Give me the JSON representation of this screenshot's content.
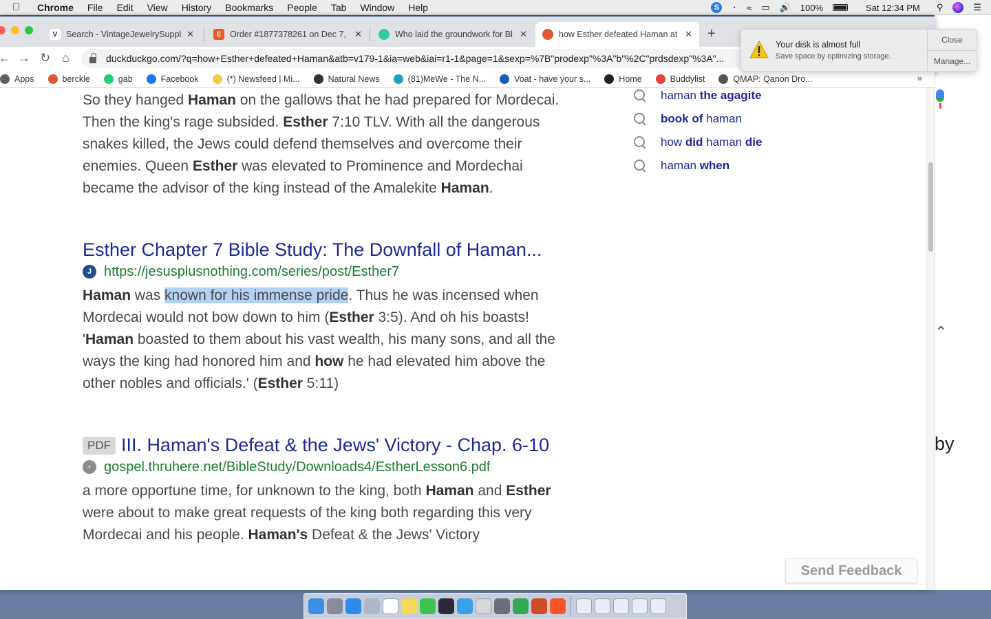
{
  "menubar": {
    "app": "Chrome",
    "items": [
      "File",
      "Edit",
      "View",
      "History",
      "Bookmarks",
      "People",
      "Tab",
      "Window",
      "Help"
    ],
    "battery": "100%",
    "clock": "Sat 12:34 PM",
    "skype_badge": "S"
  },
  "tabs": [
    {
      "title": "Search - VintageJewelrySuppl",
      "favicon": "V",
      "color": "#444444"
    },
    {
      "title": "Order #1877378261 on Dec 7,",
      "favicon": "E",
      "color": "#f05a1a"
    },
    {
      "title": "Who laid the groundwork for Bl",
      "favicon": "",
      "color": "#32c8a8"
    },
    {
      "title": "how Esther defeated Haman at",
      "favicon": "",
      "color": "#de5833"
    }
  ],
  "toolbar": {
    "url": "duckduckgo.com/?q=how+Esther+defeated+Haman&atb=v179-1&ia=web&iai=r1-1&page=1&sexp=%7B\"prodexp\"%3A\"b\"%2C\"prdsdexp\"%3A\"..."
  },
  "bookmarks": [
    {
      "label": "Apps",
      "icon": "apps-grid-icon",
      "color": "#5f6368"
    },
    {
      "label": "berckle",
      "icon": "duckduckgo-icon",
      "color": "#de5833"
    },
    {
      "label": "gab",
      "icon": "gab-icon",
      "color": "#21cf7a"
    },
    {
      "label": "Facebook",
      "icon": "facebook-icon",
      "color": "#1877f2"
    },
    {
      "label": "(*) Newsfeed | Mi...",
      "icon": "lightbulb-icon",
      "color": "#f2c94c"
    },
    {
      "label": "Natural News",
      "icon": "natural-news-icon",
      "color": "#333333"
    },
    {
      "label": "(81)MeWe - The N...",
      "icon": "mewe-icon",
      "color": "#1aa3b8"
    },
    {
      "label": "Voat - have your s...",
      "icon": "voat-icon",
      "color": "#1a5db8"
    },
    {
      "label": "Home",
      "icon": "home-glyph-icon",
      "color": "#222222"
    },
    {
      "label": "Buddylist",
      "icon": "buddylist-icon",
      "color": "#e0443e"
    },
    {
      "label": "QMAP: Qanon Dro...",
      "icon": "qmap-icon",
      "color": "#555555"
    }
  ],
  "results": {
    "first_snippet_html": "So they hanged <b>Haman</b> on the gallows that he had prepared for Mordecai. Then the king's rage subsided. <b>Esther</b> 7:10 TLV. With all the dangerous snakes killed, the Jews could defend themselves and overcome their enemies. Queen <b>Esther</b> was elevated to Prominence and Mordechai became the advisor of the king instead of the Amalekite <b>Haman</b>.",
    "r2_title": "Esther Chapter 7 Bible Study: The Downfall of Haman...",
    "r2_url": "https://jesusplusnothing.com/series/post/Esther7",
    "r2_snippet_html": "<b>Haman</b> was <span class=\"hl\">known for his immense pride</span>. Thus he was incensed when Mordecai would not bow down to him (<b>Esther</b> 3:5). And oh his boasts! '<b>Haman</b> boasted to them about his vast wealth, his many sons, and all the ways the king had honored him and <b>how</b> he had elevated him above the other nobles and officials.' (<b>Esther</b> 5:11)",
    "r3_tag": "PDF",
    "r3_title": "III. Haman's Defeat & the Jews' Victory - Chap. 6-10",
    "r3_url": "gospel.thruhere.net/BibleStudy/Downloads4/EstherLesson6.pdf",
    "r3_snippet_html": "a more opportune time, for unknown to the king, both <b>Haman</b> and <b>Esther</b> were about to make great requests of the king both regarding this very Mordecai and his people. <b>Haman's</b> Defeat &amp; the Jews' Victory"
  },
  "related": [
    {
      "html": "haman <b>the agagite</b>"
    },
    {
      "html": "<b>book of</b> haman"
    },
    {
      "html": "how <b>did</b> haman <b>die</b>"
    },
    {
      "html": "haman <b>when</b>"
    }
  ],
  "feedback_label": "Send Feedback",
  "side_peek_text": "by",
  "notification": {
    "title": "Your disk is almost full",
    "body": "Save space by optimizing storage.",
    "close": "Close",
    "manage": "Manage..."
  },
  "dock": [
    {
      "name": "finder-icon",
      "color": "#3a8ee6"
    },
    {
      "name": "launchpad-icon",
      "color": "#8a8a9a"
    },
    {
      "name": "safari-icon",
      "color": "#2d8ceb"
    },
    {
      "name": "help-icon",
      "color": "#b0b8c8"
    },
    {
      "name": "calendar-icon",
      "color": "#ffffff"
    },
    {
      "name": "notes-icon",
      "color": "#f7d85a"
    },
    {
      "name": "messages-icon",
      "color": "#3ec24f"
    },
    {
      "name": "quicktime-icon",
      "color": "#2a2a3a"
    },
    {
      "name": "chat-icon",
      "color": "#3aa0e8"
    },
    {
      "name": "script-editor-icon",
      "color": "#d7d7d7"
    },
    {
      "name": "system-preferences-icon",
      "color": "#6e6e78"
    },
    {
      "name": "chrome-icon",
      "color": "#34a853"
    },
    {
      "name": "powerpoint-icon",
      "color": "#d04a25"
    },
    {
      "name": "brave-icon",
      "color": "#fb542b"
    },
    {
      "name": "document-thumb-icon",
      "color": "#e9eef6"
    },
    {
      "name": "document-thumb-icon",
      "color": "#e9eef6"
    },
    {
      "name": "document-thumb-icon",
      "color": "#e9eef6"
    },
    {
      "name": "document-thumb-icon",
      "color": "#e9eef6"
    },
    {
      "name": "document-thumb-icon",
      "color": "#e9eef6"
    },
    {
      "name": "trash-icon",
      "color": "#c9ced8"
    }
  ]
}
